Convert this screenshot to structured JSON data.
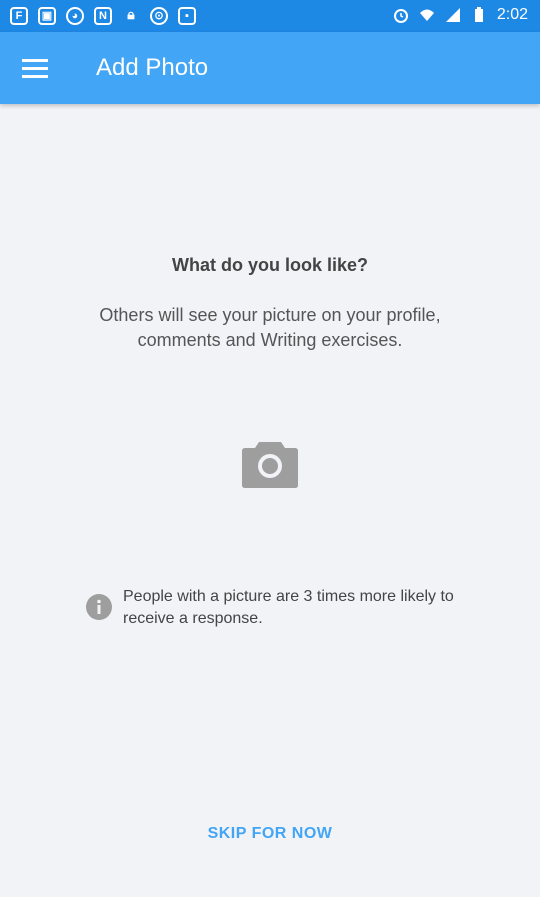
{
  "status_bar": {
    "time": "2:02",
    "left_icons": [
      "flipboard-icon",
      "image-icon",
      "cat-icon",
      "n-icon",
      "lock-icon",
      "settings-icon",
      "game-icon"
    ],
    "right_icons": [
      "alarm-icon",
      "wifi-icon",
      "signal-icon",
      "battery-icon"
    ]
  },
  "app_bar": {
    "title": "Add Photo",
    "menu_icon": "menu-icon"
  },
  "content": {
    "question": "What do you look like?",
    "description": "Others will see your picture on your profile, comments and Writing exercises.",
    "camera_icon": "camera-icon",
    "info_icon": "info-icon",
    "info_text": "People with a picture are 3 times more likely to receive a response.",
    "skip_label": "SKIP FOR NOW"
  },
  "colors": {
    "status_bar": "#1e88e5",
    "app_bar": "#42a5f5",
    "background": "#f1f3f6",
    "accent": "#42a5f5",
    "icon_gray": "#9e9e9e"
  }
}
